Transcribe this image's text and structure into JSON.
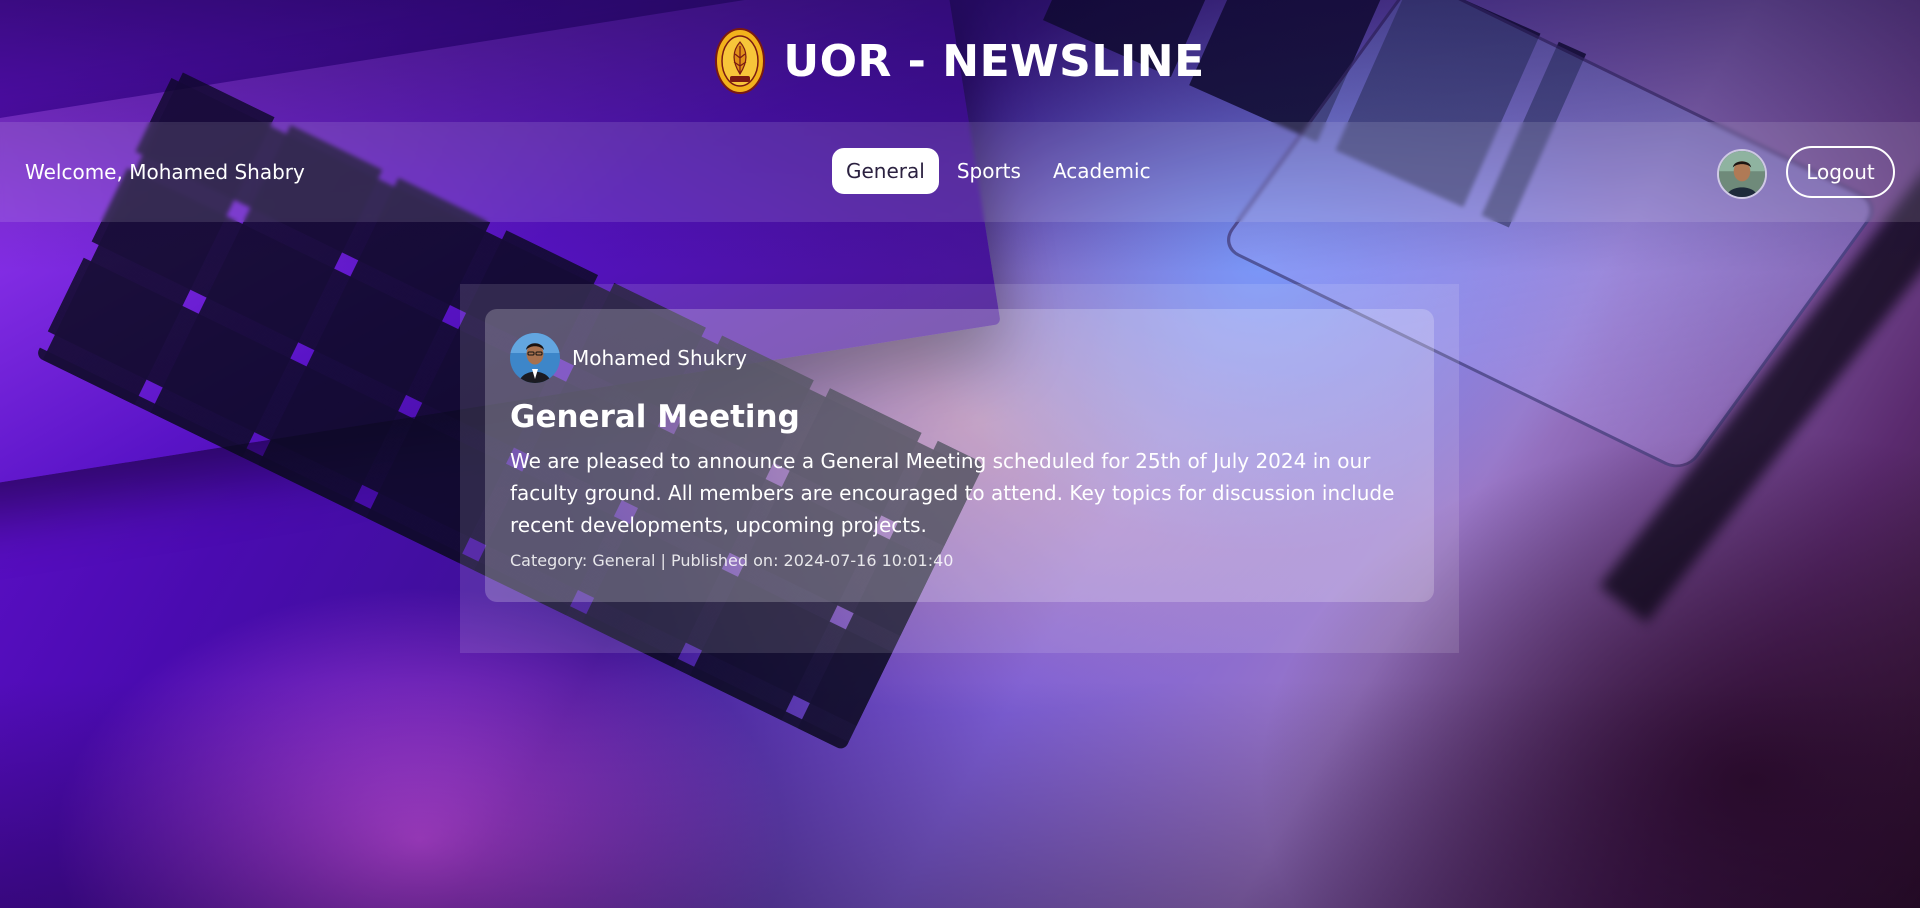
{
  "header": {
    "title": "UOR - NEWSLINE",
    "logo_icon": "university-crest-icon"
  },
  "navbar": {
    "welcome": "Welcome, Mohamed Shabry",
    "tabs": [
      {
        "label": "General",
        "active": true
      },
      {
        "label": "Sports",
        "active": false
      },
      {
        "label": "Academic",
        "active": false
      }
    ],
    "avatar_icon": "user-avatar-icon",
    "logout_label": "Logout"
  },
  "posts": [
    {
      "author": "Mohamed Shukry",
      "title": "General Meeting",
      "body": "We are pleased to announce a General Meeting scheduled for 25th of July 2024 in our faculty ground. All members are encouraged to attend. Key topics for discussion include recent developments, upcoming projects.",
      "meta": "Category: General | Published on: 2024-07-16 10:01:40"
    }
  ],
  "colors": {
    "background_primary": "#4a0bb0",
    "background_accent": "#9a78c8",
    "active_tab_bg": "#ffffff",
    "active_tab_text": "#2b2140",
    "logo_gold": "#f2b21c",
    "logo_maroon": "#7a1a12"
  }
}
